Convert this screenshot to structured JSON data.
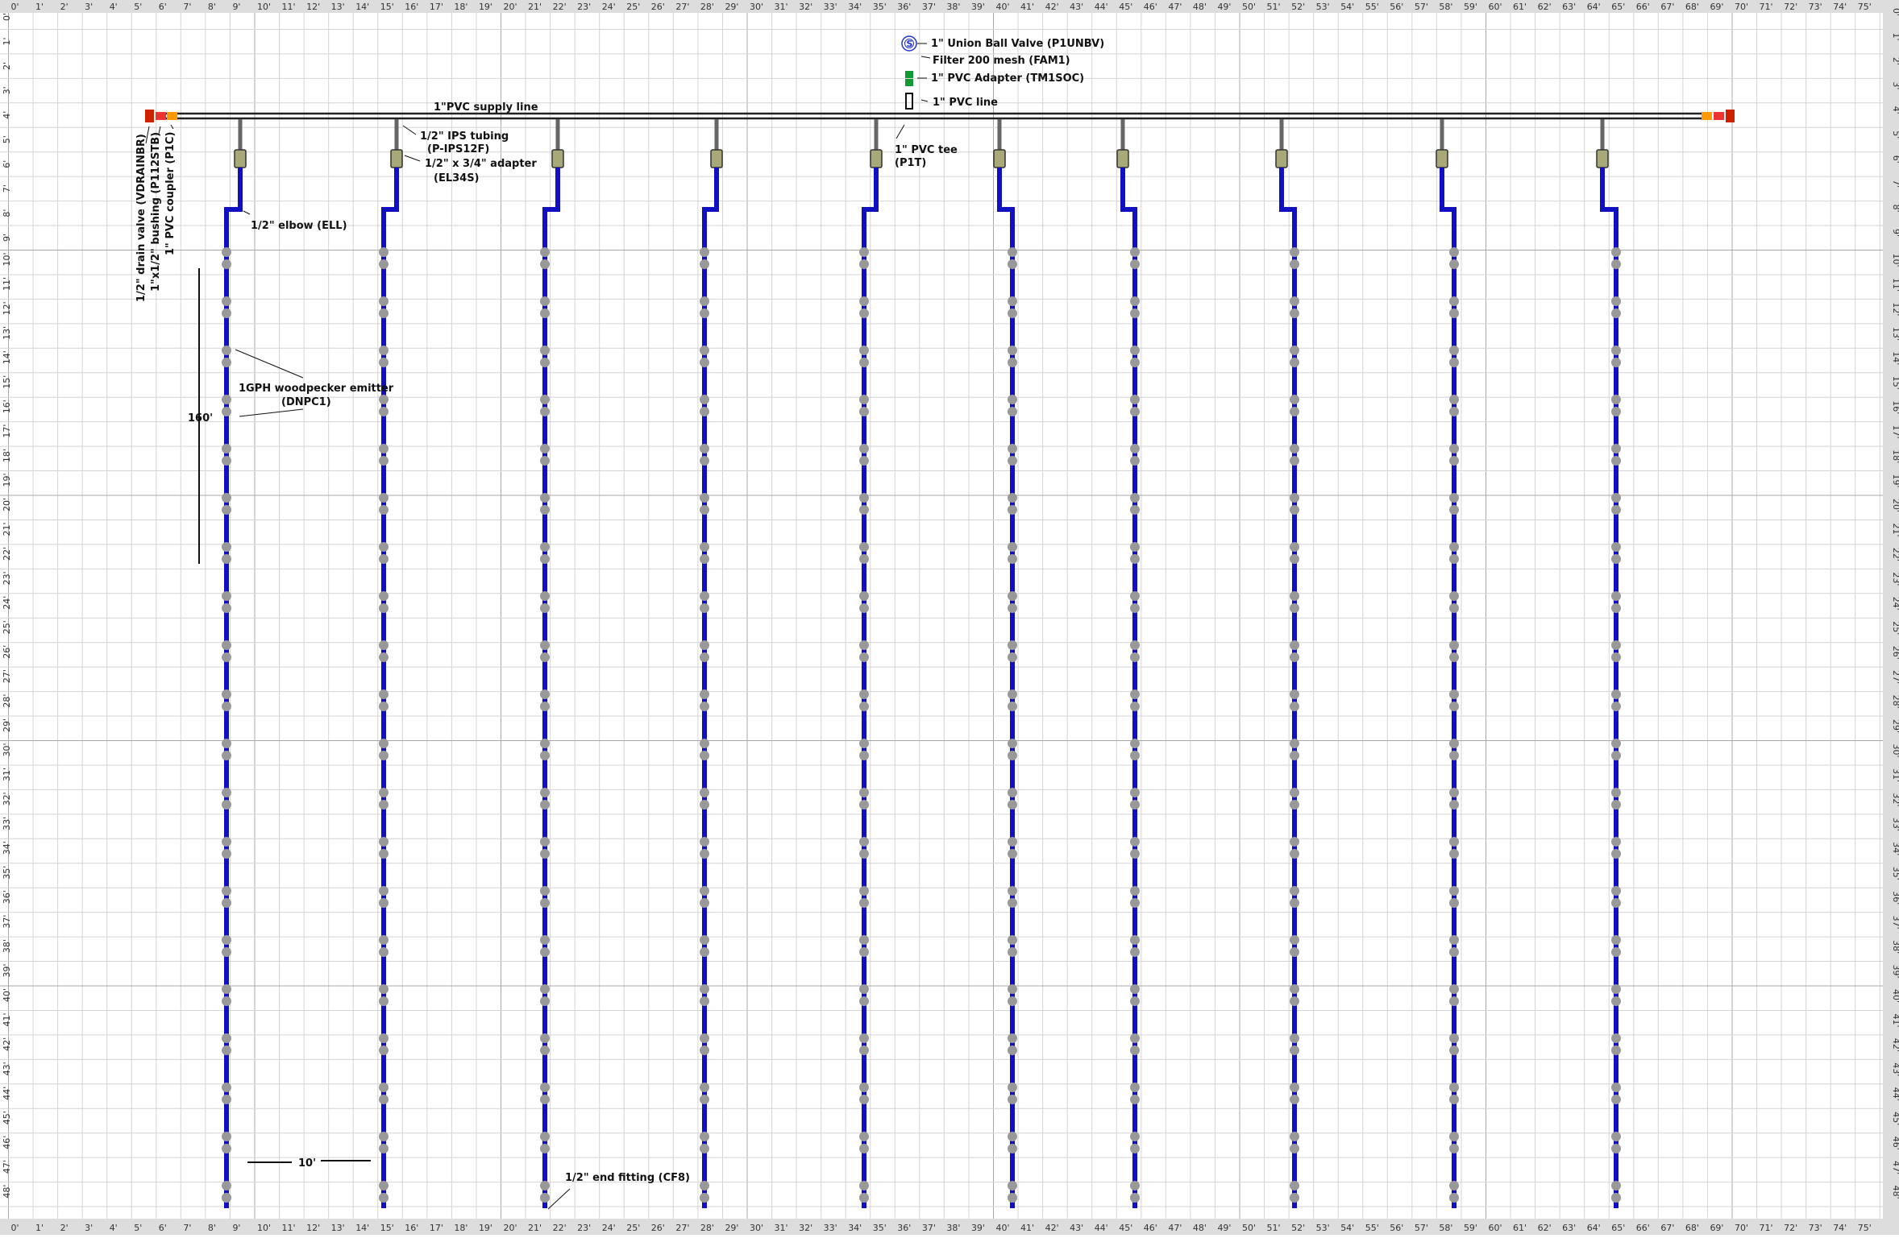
{
  "rulers": {
    "top_ticks": [
      "0'",
      "1'",
      "2'",
      "3'",
      "4'",
      "5'",
      "6'",
      "7'",
      "8'",
      "9'",
      "10'",
      "11'",
      "12'",
      "13'",
      "14'",
      "15'",
      "16'",
      "17'",
      "18'",
      "19'",
      "20'",
      "21'",
      "22'",
      "23'",
      "24'",
      "25'",
      "26'",
      "27'",
      "28'",
      "29'",
      "30'",
      "31'",
      "32'",
      "33'",
      "34'",
      "35'",
      "36'",
      "37'",
      "38'",
      "39'",
      "40'",
      "41'",
      "42'",
      "43'",
      "44'",
      "45'",
      "46'",
      "47'",
      "48'",
      "49'",
      "50'",
      "51'",
      "52'",
      "53'",
      "54'",
      "55'",
      "56'",
      "57'",
      "58'",
      "59'",
      "60'",
      "61'",
      "62'",
      "63'",
      "64'",
      "65'",
      "66'",
      "67'",
      "68'",
      "69'",
      "70'",
      "71'",
      "72'",
      "73'",
      "74'",
      "75'"
    ],
    "side_ticks": [
      "0'",
      "1'",
      "2'",
      "3'",
      "4'",
      "5'",
      "6'",
      "7'",
      "8'",
      "9'",
      "10'",
      "11'",
      "12'",
      "13'",
      "14'",
      "15'",
      "16'",
      "17'",
      "18'",
      "19'",
      "20'",
      "21'",
      "22'",
      "23'",
      "24'",
      "25'",
      "26'",
      "27'",
      "28'",
      "29'",
      "30'",
      "31'",
      "32'",
      "33'",
      "34'",
      "35'",
      "36'",
      "37'",
      "38'",
      "39'",
      "40'",
      "41'",
      "42'",
      "43'",
      "44'",
      "45'",
      "46'",
      "47'",
      "48'"
    ]
  },
  "legend": {
    "union_ball_valve": "1\" Union Ball Valve (P1UNBV)",
    "filter": "Filter 200 mesh (FAM1)",
    "pvc_adapter": "1\" PVC Adapter (TM1SOC)",
    "pvc_line": "1\" PVC line"
  },
  "labels": {
    "supply_line": "1\"PVC supply line",
    "drain_valve": "1/2\" drain valve (VDRAINBR)",
    "bushing": "1\"x1/2\" bushing (P112STB)",
    "coupler": "1\" PVC coupler (P1C)",
    "ips_tubing_1": "1/2\" IPS tubing",
    "ips_tubing_2": "(P-IPS12F)",
    "adapter_1": "1/2\" x 3/4\" adapter",
    "adapter_2": "(EL34S)",
    "elbow": "1/2\" elbow (ELL)",
    "tee_1": "1\" PVC tee",
    "tee_2": "(P1T)",
    "emitter_1": "1GPH woodpecker emitter",
    "emitter_2": "(DNPC1)",
    "length_160": "160'",
    "spacing_10": "10'",
    "end_fitting": "1/2\" end fitting (CF8)"
  },
  "colors": {
    "supply": "#222222",
    "lateral": "#1010c0",
    "emitter": "#999999",
    "adapter": "#a8a878",
    "riser": "#666666",
    "coupler": "#ff9900",
    "bushing": "#ee3333",
    "drain": "#cc2200",
    "pvc_adapter_legend": "#119933",
    "valve_legend": "#2233cc"
  },
  "laterals_count": 10
}
